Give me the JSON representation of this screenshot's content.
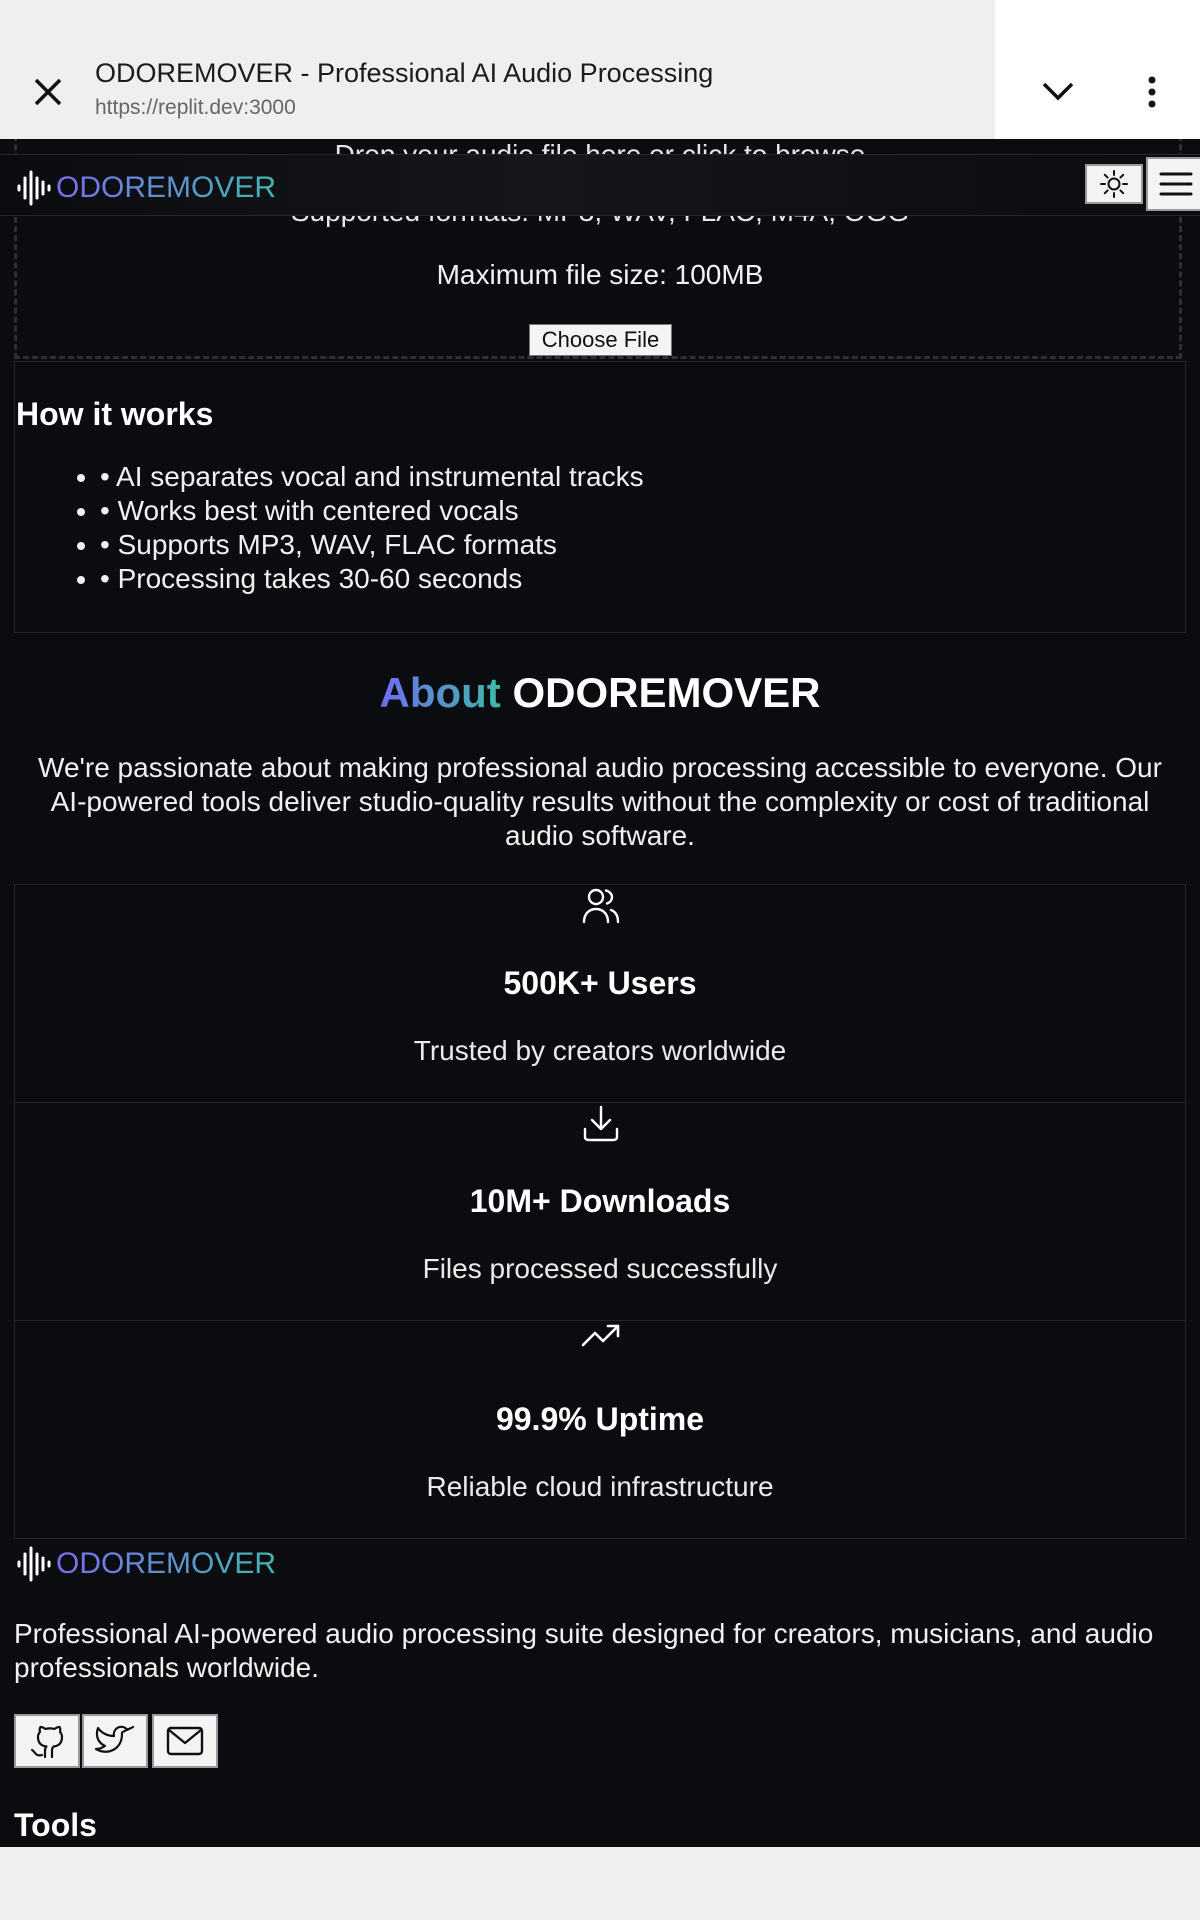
{
  "browser": {
    "title": "ODOREMOVER - Professional AI Audio Processing",
    "url": "https://replit.dev:3000"
  },
  "upload": {
    "drop_text": "Drop your audio file here or click to browse",
    "formats": "Supported formats: MP3, WAV, FLAC, M4A, OGG",
    "max_size": "Maximum file size: 100MB",
    "choose_file": "Choose File"
  },
  "nav": {
    "logo_text": "ODOREMOVER"
  },
  "how": {
    "title": "How it works",
    "items": [
      "• AI separates vocal and instrumental tracks",
      "• Works best with centered vocals",
      "• Supports MP3, WAV, FLAC formats",
      "• Processing takes 30-60 seconds"
    ]
  },
  "about": {
    "title_accent": "About",
    "title_rest": "ODOREMOVER",
    "text": "We're passionate about making professional audio processing accessible to everyone. Our AI-powered tools deliver studio-quality results without the complexity or cost of traditional audio software."
  },
  "stats": [
    {
      "icon": "users-icon",
      "title": "500K+ Users",
      "subtitle": "Trusted by creators worldwide"
    },
    {
      "icon": "download-icon",
      "title": "10M+ Downloads",
      "subtitle": "Files processed successfully"
    },
    {
      "icon": "trending-up-icon",
      "title": "99.9% Uptime",
      "subtitle": "Reliable cloud infrastructure"
    }
  ],
  "footer": {
    "logo_text": "ODOREMOVER",
    "description": "Professional AI-powered audio processing suite designed for creators, musicians, and audio professionals worldwide.",
    "tools_title": "Tools"
  },
  "colors": {
    "page_bg": "#0b0c10",
    "accent_start": "#7c6cf0",
    "accent_end": "#3fb8b0"
  }
}
